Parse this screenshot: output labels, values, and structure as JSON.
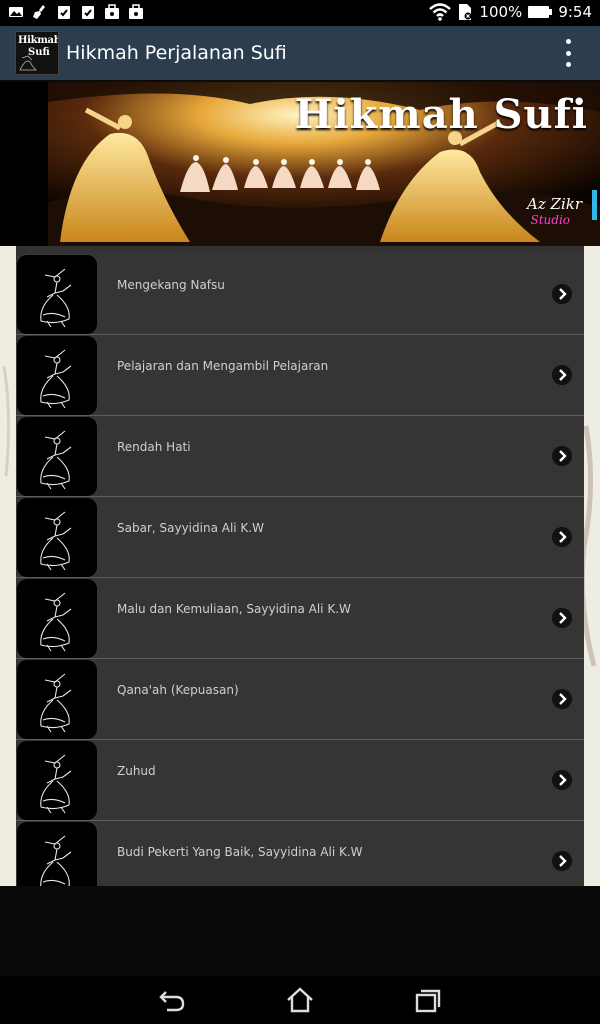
{
  "status_bar": {
    "notifications": [
      "image-icon",
      "broom-icon",
      "clipboard-check-icon",
      "clipboard-check-icon",
      "briefcase-icon",
      "briefcase-icon"
    ],
    "battery_percent": "100%",
    "time": "9:54"
  },
  "app_bar": {
    "logo_line1": "Hikmah",
    "logo_line2": "Sufi",
    "title": "Hikmah Perjalanan Sufi",
    "menu_icon": "overflow-menu-icon"
  },
  "banner": {
    "title": "Hikmah Sufi",
    "credit": "Az Zikr",
    "studio": "Studio"
  },
  "list": {
    "items": [
      {
        "label": "Mengekang Nafsu"
      },
      {
        "label": "Pelajaran dan Mengambil Pelajaran"
      },
      {
        "label": "Rendah Hati"
      },
      {
        "label": "Sabar, Sayyidina Ali K.W"
      },
      {
        "label": "Malu dan Kemuliaan, Sayyidina Ali K.W"
      },
      {
        "label": "Qana'ah (Kepuasan)"
      },
      {
        "label": "Zuhud"
      },
      {
        "label": "Budi Pekerti Yang Baik, Sayyidina Ali K.W"
      }
    ]
  },
  "nav_bar": {
    "buttons": [
      "back-icon",
      "home-icon",
      "recent-apps-icon"
    ]
  },
  "colors": {
    "app_bar": "#2b3d4f",
    "list_item": "#353535",
    "banner_studio": "#ff3fd8"
  }
}
